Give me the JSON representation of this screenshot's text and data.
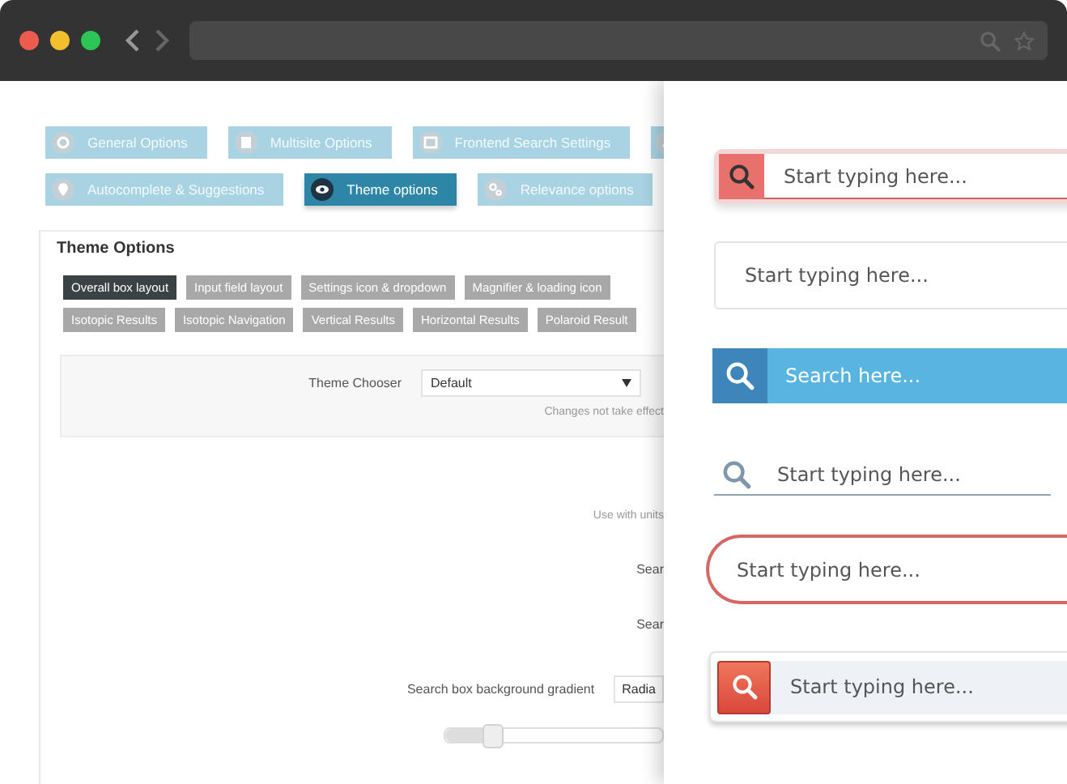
{
  "option_tabs": [
    {
      "label": "General Options",
      "selected": false
    },
    {
      "label": "Multisite Options",
      "selected": false
    },
    {
      "label": "Frontend Search Settings",
      "selected": false
    },
    {
      "selected": false
    },
    {
      "label": "Autocomplete & Suggestions",
      "selected": false
    },
    {
      "label": "Theme options",
      "selected": true
    },
    {
      "label": "Relevance options",
      "selected": false
    }
  ],
  "theme_options": {
    "title": "Theme Options",
    "tabs": [
      {
        "label": "Overall box layout",
        "selected": true
      },
      {
        "label": "Input field layout",
        "selected": false
      },
      {
        "label": "Settings icon & dropdown",
        "selected": false
      },
      {
        "label": "Magnifier & loading icon",
        "selected": false
      },
      {
        "label": "Isotopic Results",
        "selected": false
      },
      {
        "label": "Isotopic Navigation",
        "selected": false
      },
      {
        "label": "Vertical Results",
        "selected": false
      },
      {
        "label": "Horizontal Results",
        "selected": false
      },
      {
        "label": "Polaroid Result",
        "selected": false
      }
    ]
  },
  "theme_chooser": {
    "label": "Theme Chooser",
    "value": "Default",
    "note": "Changes not take effect"
  },
  "units_note": "Use with units",
  "setting_rows": [
    {
      "label": "Sear"
    },
    {
      "label": "Sear"
    }
  ],
  "gradient": {
    "label": "Search box background gradient",
    "value": "Radia",
    "level": 0.22
  },
  "search_demos": [
    {
      "kind": "red-icon",
      "placeholder": "Start typing here..."
    },
    {
      "kind": "plain",
      "placeholder": "Start typing here..."
    },
    {
      "kind": "blue",
      "placeholder": "Search here..."
    },
    {
      "kind": "underline",
      "placeholder": "Start typing here..."
    },
    {
      "kind": "rounded",
      "placeholder": "Start typing here..."
    },
    {
      "kind": "red-button",
      "placeholder": "Start typing here..."
    }
  ]
}
